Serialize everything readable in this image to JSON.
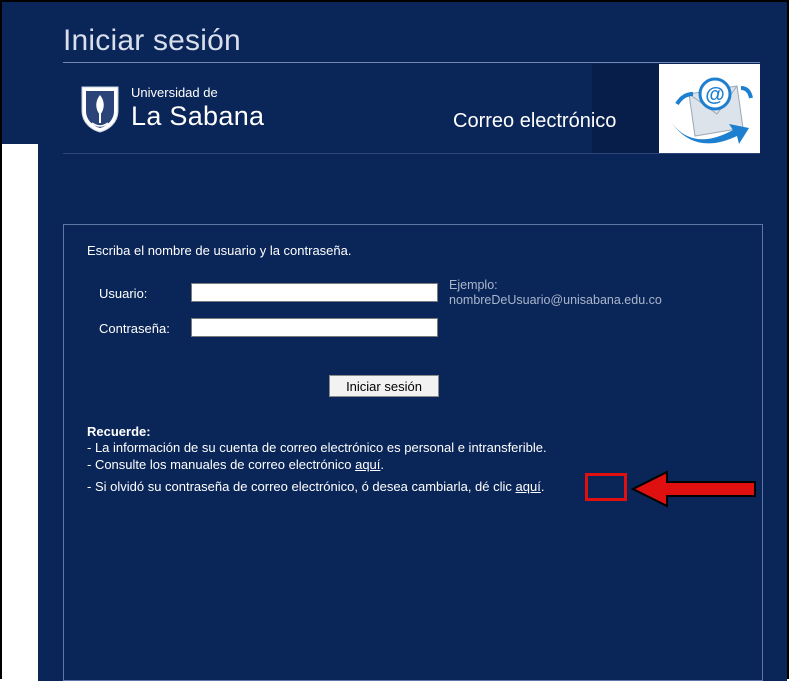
{
  "header": {
    "title": "Iniciar sesión",
    "university_small": "Universidad de",
    "university_big": "La Sabana",
    "service_title": "Correo electrónico"
  },
  "form": {
    "instructions": "Escriba el nombre de usuario y la contraseña.",
    "username_label": "Usuario:",
    "username_value": "",
    "username_hint_1": "Ejemplo:",
    "username_hint_2": "nombreDeUsuario@unisabana.edu.co",
    "password_label": "Contraseña:",
    "password_value": "",
    "submit_label": "Iniciar sesión"
  },
  "reminder": {
    "title": "Recuerde:",
    "line1": "- La información de su cuenta de correo electrónico es personal e intransferible.",
    "line2_prefix": "- Consulte los manuales de correo electrónico ",
    "line2_link": "aquí",
    "line2_suffix": ".",
    "line3_prefix": "- Si olvidó su contraseña de correo electrónico, ó desea cambiarla, dé clic ",
    "line3_link": "aquí",
    "line3_suffix": "."
  },
  "colors": {
    "background_navy": "#0a2557",
    "annotation_red": "#e01010"
  },
  "icons": {
    "logo": "university-shield-icon",
    "mail": "email-at-icon",
    "annotation": "red-arrow-icon"
  }
}
